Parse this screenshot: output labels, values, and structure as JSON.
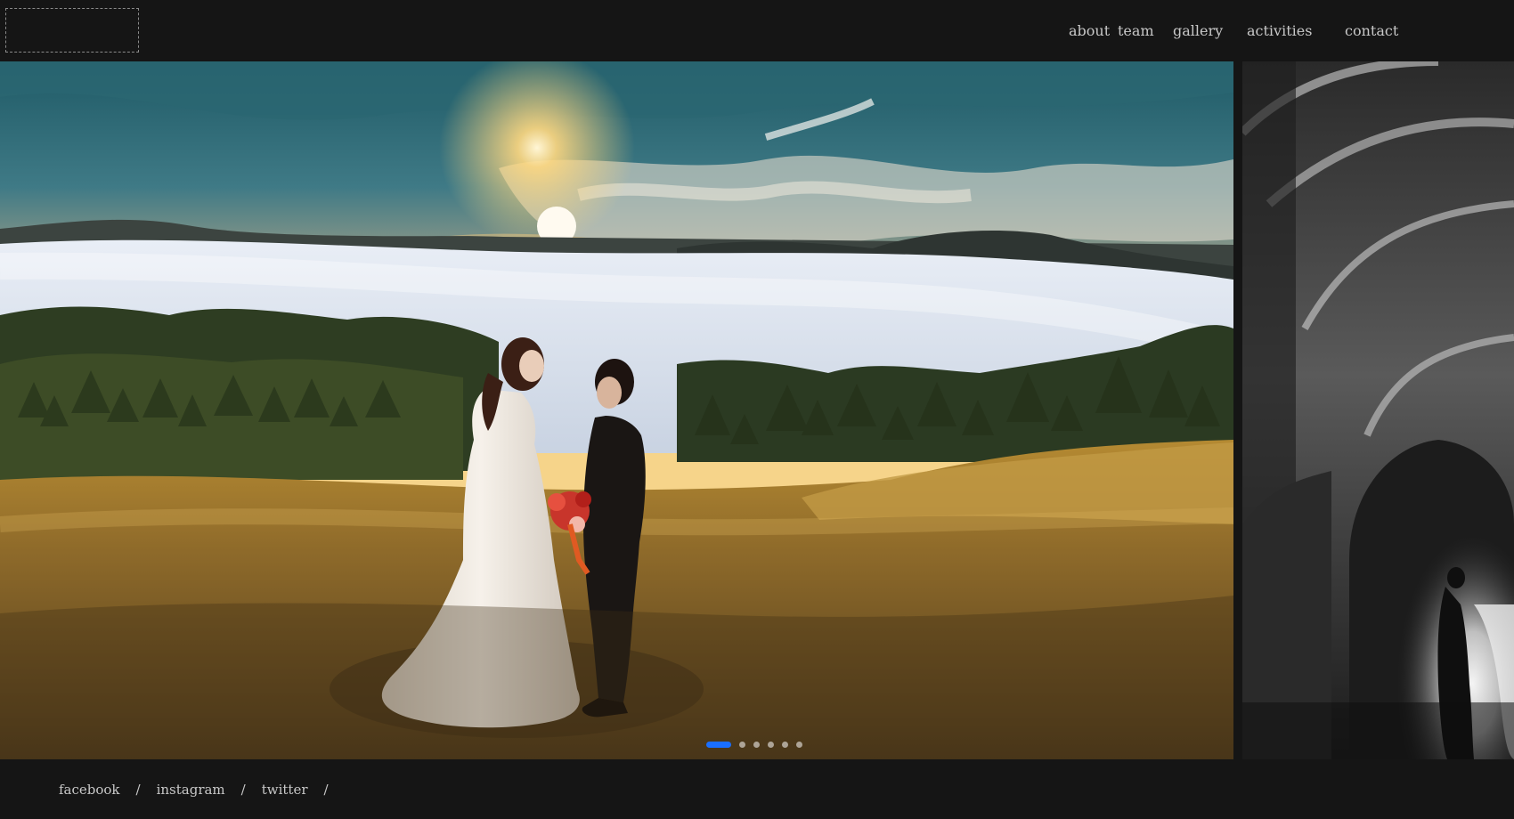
{
  "nav": {
    "items": [
      {
        "label": "about"
      },
      {
        "label": "team"
      },
      {
        "label": "gallery"
      },
      {
        "label": "activities"
      },
      {
        "label": "contact"
      }
    ]
  },
  "carousel": {
    "slide_count": 6,
    "active_index": 0,
    "active_color": "#1a6fff"
  },
  "footer": {
    "social": [
      {
        "label": "facebook"
      },
      {
        "label": "instagram"
      },
      {
        "label": "twitter"
      }
    ],
    "separator": "/"
  }
}
